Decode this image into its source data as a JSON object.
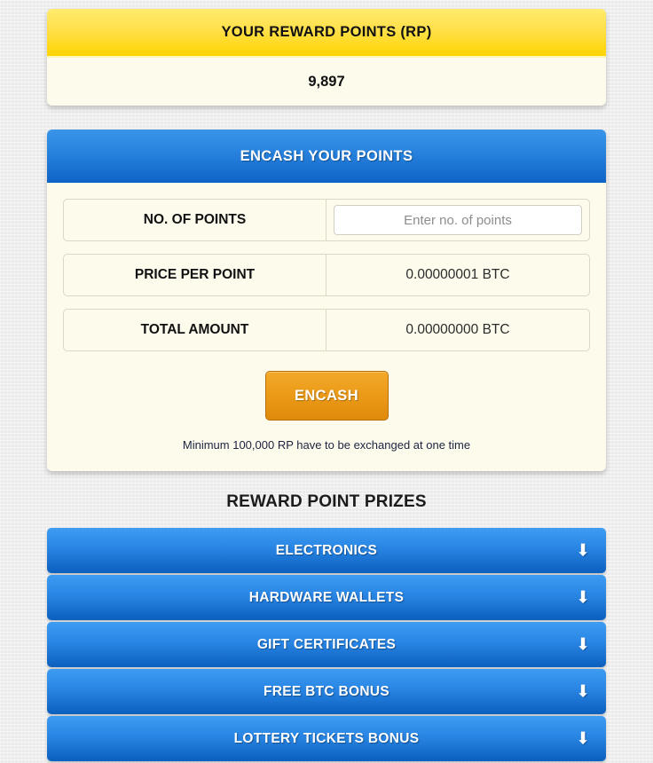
{
  "reward_points": {
    "header": "YOUR REWARD POINTS (RP)",
    "value": "9,897"
  },
  "encash_panel": {
    "header": "ENCASH YOUR POINTS",
    "rows": [
      {
        "label": "NO. OF POINTS",
        "value": "",
        "placeholder": "Enter no. of points",
        "type": "input"
      },
      {
        "label": "PRICE PER POINT",
        "value": "0.00000001 BTC",
        "type": "text"
      },
      {
        "label": "TOTAL AMOUNT",
        "value": "0.00000000 BTC",
        "type": "text"
      }
    ],
    "submit_label": "ENCASH",
    "min_note": "Minimum 100,000 RP have to be exchanged at one time"
  },
  "prizes": {
    "title": "REWARD POINT PRIZES",
    "arrow_icon": "⬇",
    "items": [
      {
        "label": "ELECTRONICS"
      },
      {
        "label": "HARDWARE WALLETS"
      },
      {
        "label": "GIFT CERTIFICATES"
      },
      {
        "label": "FREE BTC BONUS"
      },
      {
        "label": "LOTTERY TICKETS BONUS"
      }
    ]
  },
  "colors": {
    "page_bg": "#ebebeb",
    "yellow_top": "#ffeb6e",
    "yellow_bottom": "#ffd400",
    "cream": "#fdfbec",
    "blue_top": "#3a95e8",
    "blue_bottom": "#0f63c6",
    "orange_top": "#f3a829",
    "orange_bottom": "#df8a0b"
  }
}
